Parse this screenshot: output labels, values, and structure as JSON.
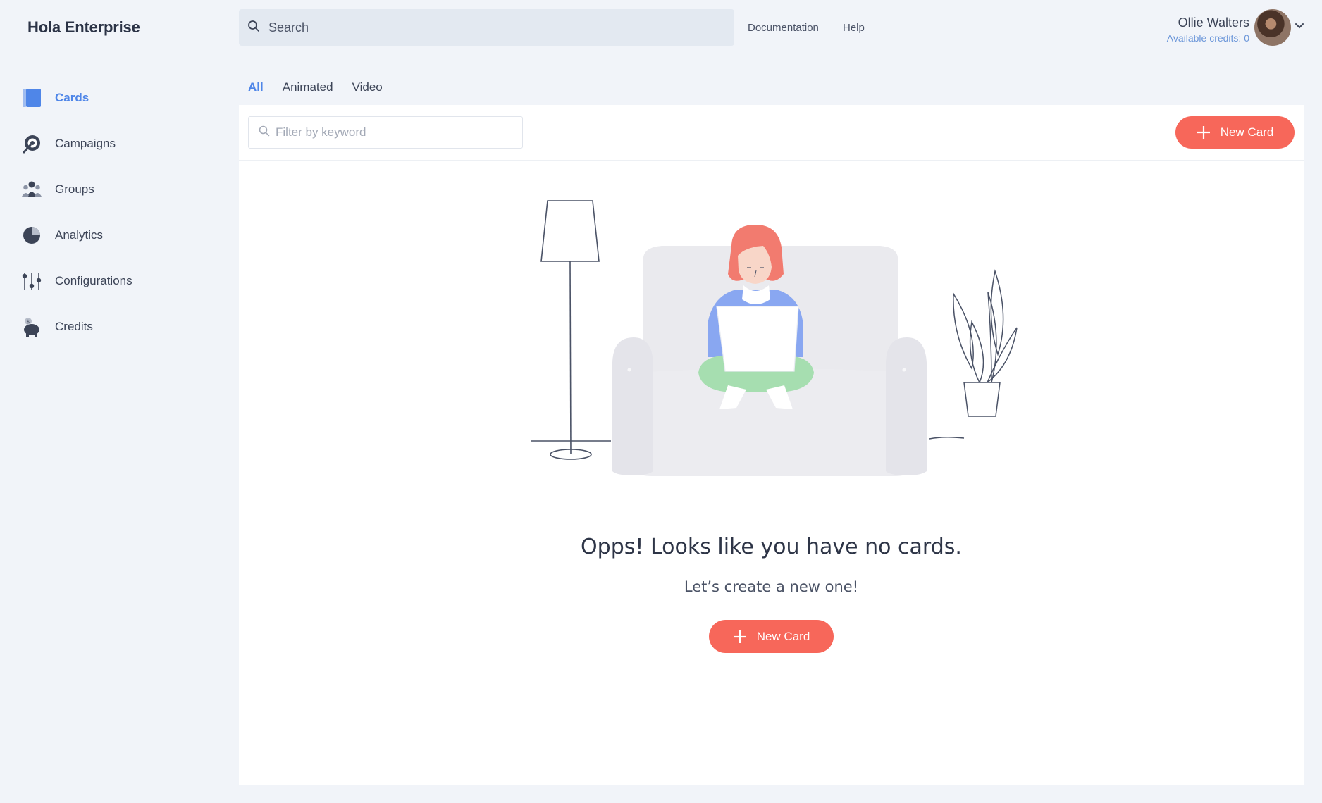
{
  "app": {
    "brand": "Hola Enterprise"
  },
  "header": {
    "search_placeholder": "Search",
    "links": [
      "Documentation",
      "Help"
    ],
    "user_name": "Ollie Walters",
    "credits_text": "Available credits: 0"
  },
  "sidebar": {
    "items": [
      {
        "label": "Cards",
        "icon": "cards-icon",
        "active": true
      },
      {
        "label": "Campaigns",
        "icon": "campaigns-icon"
      },
      {
        "label": "Groups",
        "icon": "groups-icon"
      },
      {
        "label": "Analytics",
        "icon": "analytics-pie-icon"
      },
      {
        "label": "Configurations",
        "icon": "sliders-icon"
      },
      {
        "label": "Credits",
        "icon": "piggy-bank-icon"
      }
    ]
  },
  "tabs": [
    {
      "label": "All",
      "active": true
    },
    {
      "label": "Animated"
    },
    {
      "label": "Video"
    }
  ],
  "toolbar": {
    "filter_placeholder": "Filter by keyword",
    "new_card_label": "New Card"
  },
  "empty_state": {
    "title": "Opps! Looks like you have no cards.",
    "subtitle": "Let’s create a new one!",
    "button_label": "New Card"
  },
  "colors": {
    "accent": "#4f86e8",
    "primary_button": "#f7675a",
    "background": "#f1f4f9"
  }
}
